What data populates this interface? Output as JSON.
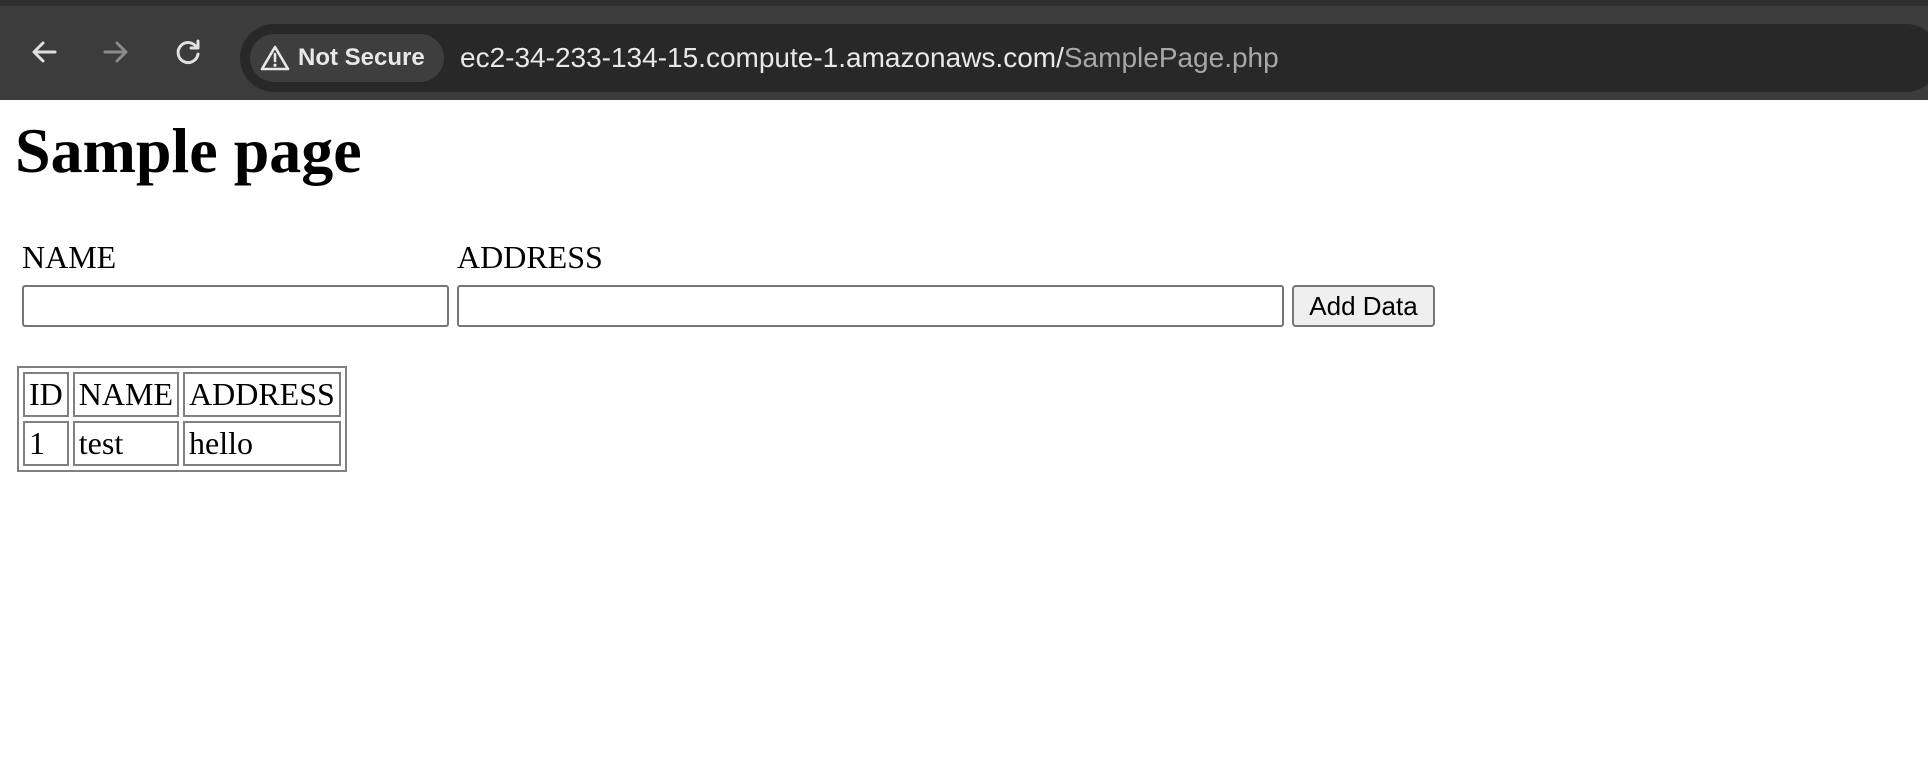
{
  "browser": {
    "security_label": "Not Secure",
    "url_host": "ec2-34-233-134-15.compute-1.amazonaws.com/",
    "url_path": "SamplePage.php",
    "icons": {
      "back": "arrow-left-icon",
      "forward": "arrow-right-icon",
      "reload": "reload-icon",
      "security": "warning-triangle-icon"
    }
  },
  "page": {
    "title": "Sample page",
    "form": {
      "name_label": "NAME",
      "address_label": "ADDRESS",
      "name_value": "",
      "address_value": "",
      "submit_label": "Add Data"
    },
    "table": {
      "headers": [
        "ID",
        "NAME",
        "ADDRESS"
      ],
      "rows": [
        [
          "1",
          "test",
          "hello"
        ]
      ]
    }
  },
  "colors": {
    "toolbar_bg": "#3c3c3c",
    "omnibox_bg": "#282828",
    "chip_bg": "#3e3e3e",
    "url_host": "#e8e8e8",
    "url_path": "#a8a8a8",
    "button_bg": "#efefef"
  }
}
